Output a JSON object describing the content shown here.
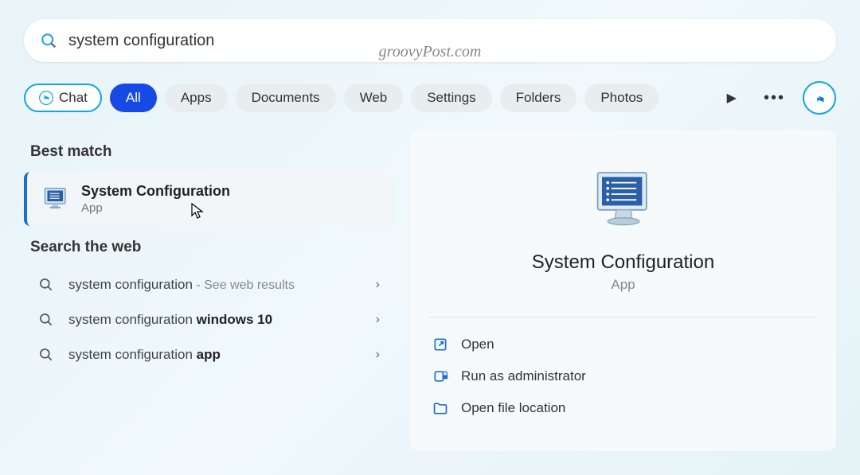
{
  "watermark": "groovyPost.com",
  "search": {
    "query": "system configuration"
  },
  "filters": {
    "chat": "Chat",
    "tabs": [
      "All",
      "Apps",
      "Documents",
      "Web",
      "Settings",
      "Folders",
      "Photos"
    ],
    "active_index": 0
  },
  "sections": {
    "best_match": "Best match",
    "search_web": "Search the web"
  },
  "best_match": {
    "title": "System Configuration",
    "subtitle": "App"
  },
  "web_results": [
    {
      "prefix": "system configuration",
      "bold": "",
      "suffix": " - See web results"
    },
    {
      "prefix": "system configuration ",
      "bold": "windows 10",
      "suffix": ""
    },
    {
      "prefix": "system configuration ",
      "bold": "app",
      "suffix": ""
    }
  ],
  "detail": {
    "title": "System Configuration",
    "subtitle": "App",
    "actions": [
      {
        "icon": "open",
        "label": "Open"
      },
      {
        "icon": "admin",
        "label": "Run as administrator"
      },
      {
        "icon": "folder",
        "label": "Open file location"
      }
    ]
  }
}
